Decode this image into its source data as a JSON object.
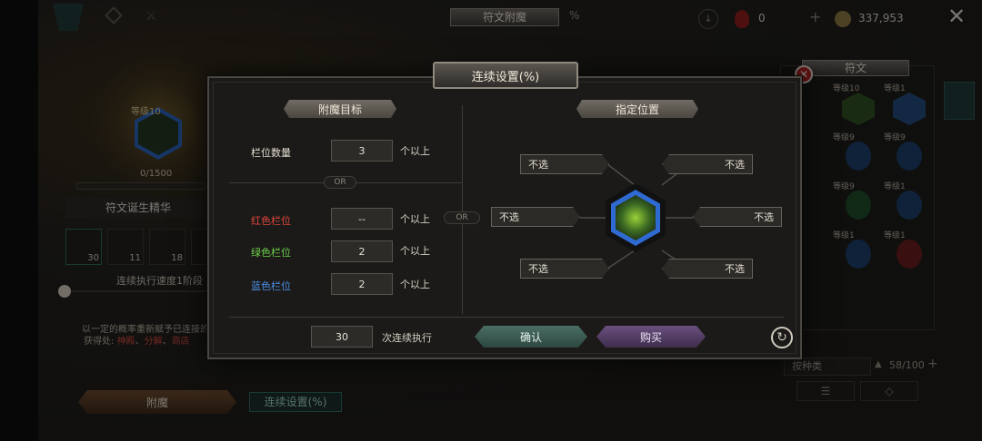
{
  "top": {
    "tab_title": "符文附魔",
    "tab_percent": "%",
    "gem_count": "0",
    "gold_amount": "337,953",
    "plus": "+",
    "close": "✕"
  },
  "left_panel": {
    "rune_level": "等级10",
    "progress": "0/1500",
    "essence_title": "符文诞生精华",
    "materials": [
      {
        "count": "30"
      },
      {
        "count": "11"
      },
      {
        "count": "18"
      }
    ],
    "speed_label": "连续执行速度1阶段",
    "desc_line1": "以一定的概率重新赋予已连接的",
    "desc_line2_prefix": "获得处:",
    "desc_links": [
      "神殿",
      "分解",
      "商店"
    ],
    "enchant_button": "附魔",
    "continuous_button": "连续设置(%)"
  },
  "right_panel": {
    "title": "符文",
    "sort_label": "按种类",
    "capacity": "58/100",
    "items": [
      {
        "level": "等级10"
      },
      {
        "level": "等级1"
      },
      {
        "level": "等级9"
      },
      {
        "level": "等级9"
      },
      {
        "level": "等级9"
      },
      {
        "level": "等级1"
      },
      {
        "level": "等级1"
      },
      {
        "level": "等级1"
      }
    ]
  },
  "modal": {
    "title": "连续设置(%)",
    "target_header": "附魔目标",
    "position_header": "指定位置",
    "slot_count_label": "栏位数量",
    "slot_count_value": "3",
    "unit_more": "个以上",
    "or": "OR",
    "red_label": "红色栏位",
    "red_value": "--",
    "green_label": "绿色栏位",
    "green_value": "2",
    "blue_label": "蓝色栏位",
    "blue_value": "2",
    "positions": [
      "不选",
      "不选",
      "不选",
      "不选",
      "不选",
      "不选"
    ],
    "repeat_value": "30",
    "repeat_label": "次连续执行",
    "confirm": "确认",
    "buy": "购买"
  },
  "colors": {
    "red_label": "#e0463c",
    "green_label": "#6fd04a",
    "blue_label": "#4b8fe6",
    "confirm_button": "#3f6258",
    "buy_button": "#584268"
  }
}
